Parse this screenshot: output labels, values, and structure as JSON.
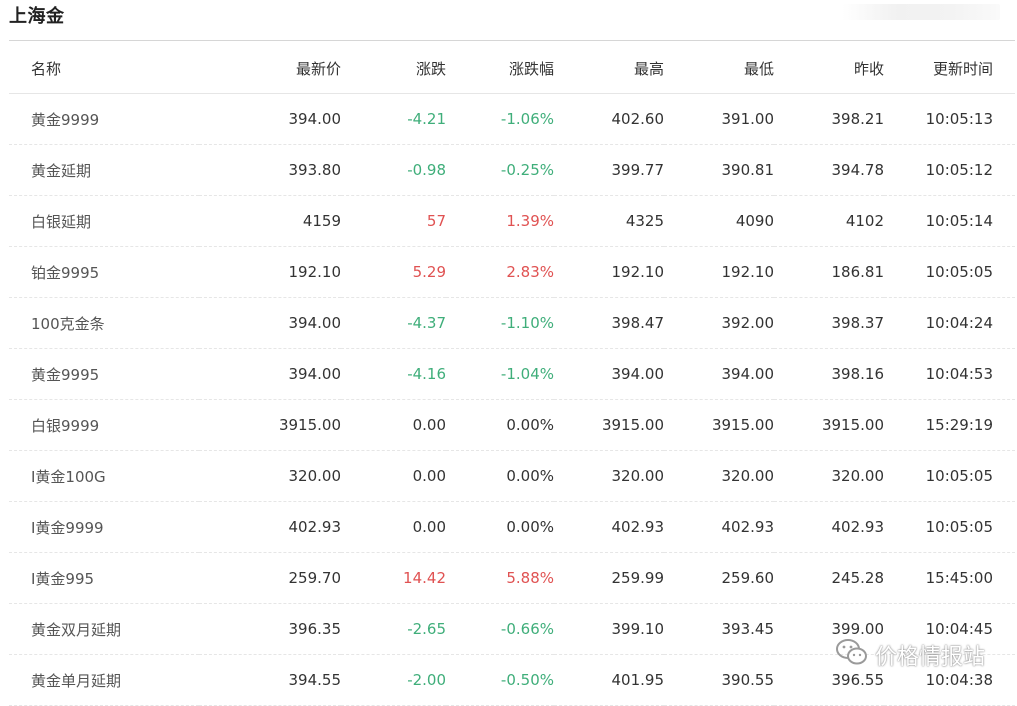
{
  "page": {
    "title": "上海金"
  },
  "table": {
    "headers": {
      "name": "名称",
      "latest": "最新价",
      "change": "涨跌",
      "change_pct": "涨跌幅",
      "high": "最高",
      "low": "最低",
      "prev_close": "昨收",
      "update_time": "更新时间"
    },
    "rows": [
      {
        "name": "黄金9999",
        "latest": "394.00",
        "change": "-4.21",
        "change_pct": "-1.06%",
        "high": "402.60",
        "low": "391.00",
        "prev_close": "398.21",
        "update_time": "10:05:13",
        "trend": "down"
      },
      {
        "name": "黄金延期",
        "latest": "393.80",
        "change": "-0.98",
        "change_pct": "-0.25%",
        "high": "399.77",
        "low": "390.81",
        "prev_close": "394.78",
        "update_time": "10:05:12",
        "trend": "down"
      },
      {
        "name": "白银延期",
        "latest": "4159",
        "change": "57",
        "change_pct": "1.39%",
        "high": "4325",
        "low": "4090",
        "prev_close": "4102",
        "update_time": "10:05:14",
        "trend": "up"
      },
      {
        "name": "铂金9995",
        "latest": "192.10",
        "change": "5.29",
        "change_pct": "2.83%",
        "high": "192.10",
        "low": "192.10",
        "prev_close": "186.81",
        "update_time": "10:05:05",
        "trend": "up"
      },
      {
        "name": "100克金条",
        "latest": "394.00",
        "change": "-4.37",
        "change_pct": "-1.10%",
        "high": "398.47",
        "low": "392.00",
        "prev_close": "398.37",
        "update_time": "10:04:24",
        "trend": "down"
      },
      {
        "name": "黄金9995",
        "latest": "394.00",
        "change": "-4.16",
        "change_pct": "-1.04%",
        "high": "394.00",
        "low": "394.00",
        "prev_close": "398.16",
        "update_time": "10:04:53",
        "trend": "down"
      },
      {
        "name": "白银9999",
        "latest": "3915.00",
        "change": "0.00",
        "change_pct": "0.00%",
        "high": "3915.00",
        "low": "3915.00",
        "prev_close": "3915.00",
        "update_time": "15:29:19",
        "trend": "flat"
      },
      {
        "name": "I黄金100G",
        "latest": "320.00",
        "change": "0.00",
        "change_pct": "0.00%",
        "high": "320.00",
        "low": "320.00",
        "prev_close": "320.00",
        "update_time": "10:05:05",
        "trend": "flat"
      },
      {
        "name": "I黄金9999",
        "latest": "402.93",
        "change": "0.00",
        "change_pct": "0.00%",
        "high": "402.93",
        "low": "402.93",
        "prev_close": "402.93",
        "update_time": "10:05:05",
        "trend": "flat"
      },
      {
        "name": "I黄金995",
        "latest": "259.70",
        "change": "14.42",
        "change_pct": "5.88%",
        "high": "259.99",
        "low": "259.60",
        "prev_close": "245.28",
        "update_time": "15:45:00",
        "trend": "up"
      },
      {
        "name": "黄金双月延期",
        "latest": "396.35",
        "change": "-2.65",
        "change_pct": "-0.66%",
        "high": "399.10",
        "low": "393.45",
        "prev_close": "399.00",
        "update_time": "10:04:45",
        "trend": "down"
      },
      {
        "name": "黄金单月延期",
        "latest": "394.55",
        "change": "-2.00",
        "change_pct": "-0.50%",
        "high": "401.95",
        "low": "390.55",
        "prev_close": "396.55",
        "update_time": "10:04:38",
        "trend": "down"
      }
    ]
  },
  "watermark": {
    "text": "价格情报站",
    "icon": "wechat-icon"
  },
  "colors": {
    "up": "#e05252",
    "down": "#3fae7a",
    "flat": "#333333"
  }
}
